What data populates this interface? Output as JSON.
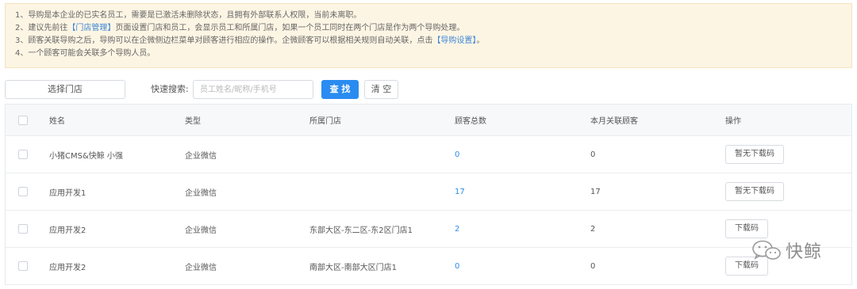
{
  "notice": {
    "line1": "1、导购是本企业的已实名员工，需要是已激活未删除状态，且拥有外部联系人权限，当前未离职。",
    "line2_pre": "2、建议先前往",
    "line2_link": "【门店管理】",
    "line2_post": "页面设置门店和员工，会显示员工和所属门店，如果一个员工同时在两个门店是作为两个导购处理。",
    "line3_pre": "3、顾客关联导购之后，导购可以在企微侧边栏菜单对顾客进行相应的操作。企微顾客可以根据相关规则自动关联，点击",
    "line3_link": "【导购设置】",
    "line3_post": "。",
    "line4": "4、一个顾客可能会关联多个导购人员。"
  },
  "toolbar": {
    "store_select": "选择门店",
    "search_label": "快速搜索:",
    "search_placeholder": "员工姓名/昵称/手机号",
    "search_value": "",
    "query_button": "查 找",
    "clear_button": "清 空"
  },
  "table": {
    "headers": {
      "name": "姓名",
      "type": "类型",
      "store": "所属门店",
      "total": "顾客总数",
      "month": "本月关联顾客",
      "op": "操作"
    },
    "rows": [
      {
        "name": "小猪CMS&快鲸 小强",
        "type": "企业微信",
        "store": "",
        "total": "0",
        "month": "0",
        "op": "暂无下载码"
      },
      {
        "name": "应用开发1",
        "type": "企业微信",
        "store": "",
        "total": "17",
        "month": "17",
        "op": "暂无下载码"
      },
      {
        "name": "应用开发2",
        "type": "企业微信",
        "store": "东部大区-东二区-东2区门店1",
        "total": "2",
        "month": "2",
        "op": "下载码"
      },
      {
        "name": "应用开发2",
        "type": "企业微信",
        "store": "南部大区-南部大区门店1",
        "total": "0",
        "month": "0",
        "op": "下载码"
      }
    ]
  },
  "watermark": {
    "text": "快鲸",
    "icon": "wechat-icon"
  },
  "colors": {
    "accent": "#2a8cf0",
    "link": "#3a86d6",
    "notice_bg": "#fdf5e4"
  }
}
